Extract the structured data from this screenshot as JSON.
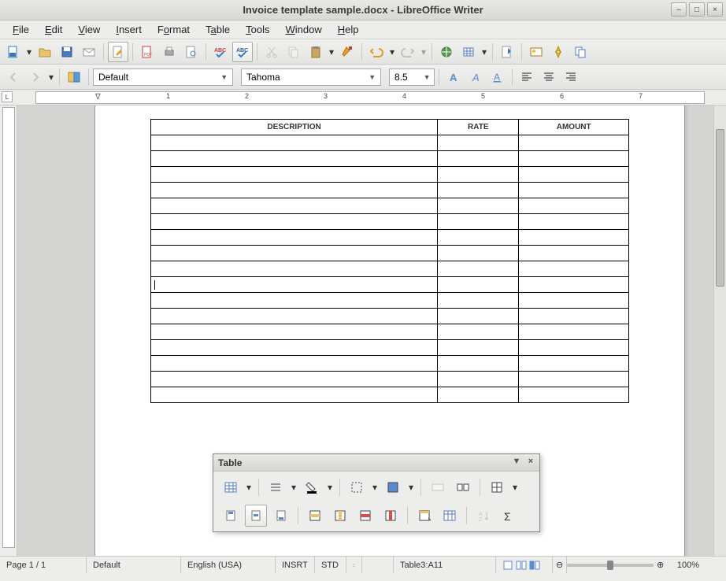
{
  "window": {
    "title": "Invoice template sample.docx - LibreOffice Writer"
  },
  "menu": {
    "file": "File",
    "edit": "Edit",
    "view": "View",
    "insert": "Insert",
    "format": "Format",
    "table": "Table",
    "tools": "Tools",
    "window": "Window",
    "help": "Help"
  },
  "formatbar": {
    "style": "Default",
    "font": "Tahoma",
    "size": "8.5"
  },
  "table_headers": {
    "col1": "DESCRIPTION",
    "col2": "RATE",
    "col3": "AMOUNT"
  },
  "float_toolbar": {
    "title": "Table"
  },
  "status": {
    "page": "Page 1 / 1",
    "style": "Default",
    "lang": "English (USA)",
    "insrt": "INSRT",
    "std": "STD",
    "cell": "Table3:A11",
    "zoom": "100%"
  },
  "ruler": {
    "n1": "1",
    "n2": "2",
    "n3": "3",
    "n4": "4",
    "n5": "5",
    "n6": "6",
    "n7": "7"
  }
}
